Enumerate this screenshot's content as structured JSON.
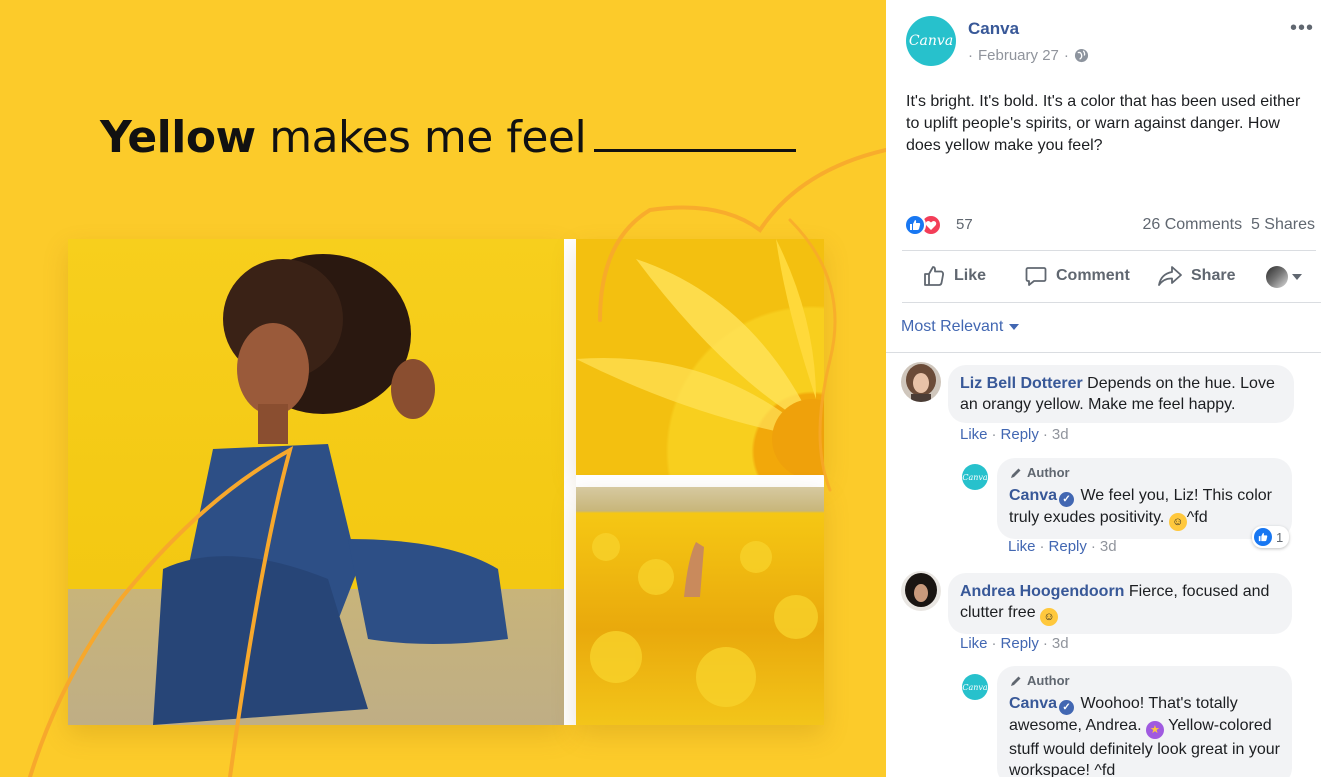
{
  "graphic": {
    "headline_bold": "Yellow",
    "headline_rest": "makes me feel"
  },
  "post": {
    "page_name": "Canva",
    "avatar_text": "Canva",
    "date": "February 27",
    "date_separator": "·",
    "privacy_icon": "globe-icon",
    "more_label": "•••",
    "text": "It's bright. It's bold. It's a color that has been used either to uplift people's spirits, or warn against danger. How does yellow make you feel?",
    "reactions_count": "57",
    "comments_count": "26 Comments",
    "shares_count": "5 Shares",
    "actions": {
      "like": "Like",
      "comment": "Comment",
      "share": "Share"
    },
    "sort_label": "Most Relevant"
  },
  "comments": [
    {
      "author": "Liz Bell Dotterer",
      "text": "Depends on the hue. Love an orangy yellow. Make me feel happy.",
      "like": "Like",
      "reply": "Reply",
      "time": "3d",
      "reply_item": {
        "badge": "Author",
        "author": "Canva",
        "text_1": "We feel you, Liz! This color truly exudes positivity.",
        "text_2": "^fd",
        "like": "Like",
        "reply": "Reply",
        "time": "3d",
        "like_count": "1"
      }
    },
    {
      "author": "Andrea Hoogendoorn",
      "text": "Fierce, focused and clutter free",
      "like": "Like",
      "reply": "Reply",
      "time": "3d",
      "reply_item": {
        "badge": "Author",
        "author": "Canva",
        "text_1": "Woohoo! That's totally awesome, Andrea.",
        "text_2": "Yellow-colored stuff would definitely look great in your workspace! ^fd"
      }
    }
  ],
  "colors": {
    "brand_yellow": "#FCCB2A",
    "link_blue": "#385898",
    "canva_teal": "#27C1CC"
  }
}
